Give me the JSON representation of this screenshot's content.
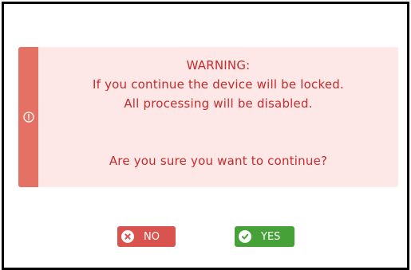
{
  "dialog": {
    "warning_title": "WARNING:",
    "message_line_1": "If you continue the device will be locked.",
    "message_line_2": "All processing will be disabled.",
    "question": "Are you sure you want to continue?",
    "icon": "exclamation-circle-icon"
  },
  "buttons": {
    "no_label": "NO",
    "no_icon": "x-circle-icon",
    "yes_label": "YES",
    "yes_icon": "check-circle-icon"
  },
  "colors": {
    "alert_background": "#fde7e7",
    "alert_stripe": "#e47164",
    "alert_text": "#c62b2b",
    "no_button": "#d9534f",
    "yes_button": "#45a138"
  }
}
